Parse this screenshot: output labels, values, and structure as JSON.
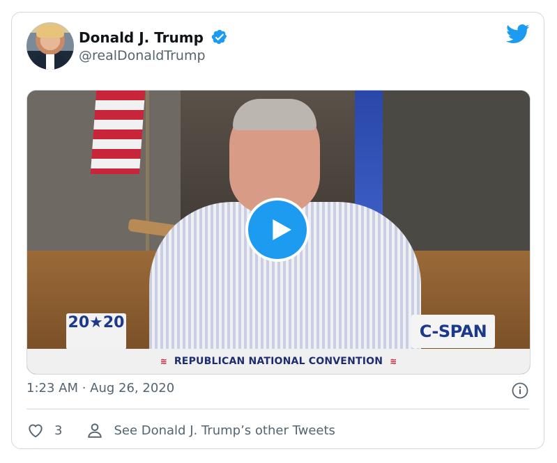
{
  "tweet": {
    "author_name": "Donald J. Trump",
    "handle": "@realDonaldTrump",
    "timestamp": "1:23 AM · Aug 26, 2020",
    "like_count": "3",
    "see_more_label": "See Donald J. Trump’s other Tweets"
  },
  "media": {
    "logo_left": "20★20",
    "logo_right": "C-SPAN",
    "banner_text": "REPUBLICAN NATIONAL CONVENTION"
  },
  "icons": {
    "verified": "verified-badge-icon",
    "brand": "twitter-bird-icon",
    "play": "play-icon",
    "info": "info-icon",
    "like": "heart-icon",
    "profile": "person-icon"
  },
  "colors": {
    "accent": "#1d9bf0",
    "secondary_text": "#536471",
    "border": "#cfd9de"
  }
}
